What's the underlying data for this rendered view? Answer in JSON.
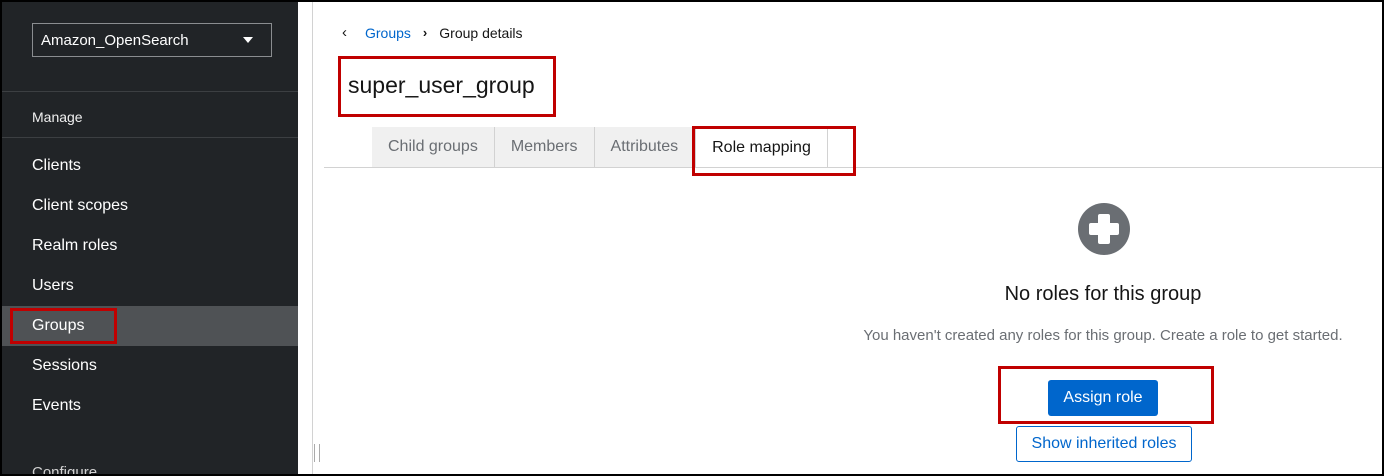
{
  "realm_selector": {
    "value": "Amazon_OpenSearch"
  },
  "sidebar": {
    "section_title": "Manage",
    "items": [
      {
        "label": "Clients"
      },
      {
        "label": "Client scopes"
      },
      {
        "label": "Realm roles"
      },
      {
        "label": "Users"
      },
      {
        "label": "Groups",
        "active": true
      },
      {
        "label": "Sessions"
      },
      {
        "label": "Events"
      }
    ],
    "next_section_peek": "Configure"
  },
  "breadcrumb": {
    "parent": "Groups",
    "current": "Group details"
  },
  "page": {
    "title": "super_user_group"
  },
  "tabs": [
    {
      "label": "Child groups"
    },
    {
      "label": "Members"
    },
    {
      "label": "Attributes"
    },
    {
      "label": "Role mapping",
      "active": true
    }
  ],
  "empty_state": {
    "icon": "plus-circle-icon",
    "title": "No roles for this group",
    "body": "You haven't created any roles for this group. Create a role to get started.",
    "primary_action": "Assign role",
    "secondary_action": "Show inherited roles"
  },
  "colors": {
    "sidebar_bg": "#212427",
    "active_nav": "#4f5255",
    "primary": "#0066cc",
    "highlight": "#c00000",
    "icon_gray": "#6a6e73"
  }
}
